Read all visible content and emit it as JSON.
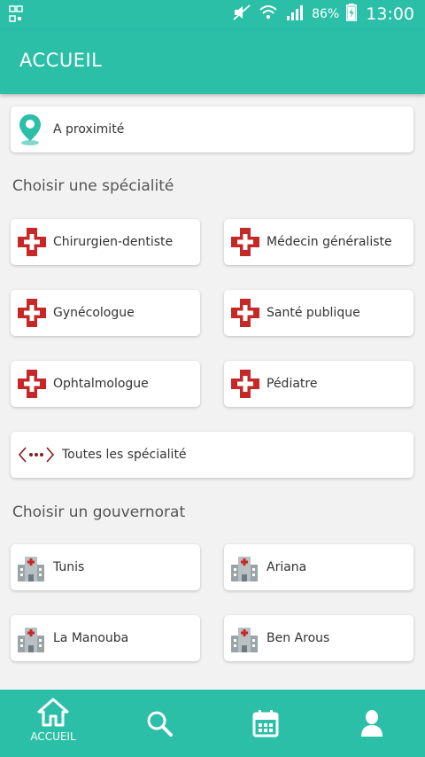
{
  "status_bar": {
    "battery": "86%",
    "time": "13:00"
  },
  "app_bar": {
    "title": "ACCUEIL"
  },
  "nearby": {
    "label": "A proximité"
  },
  "specialities": {
    "title": "Choisir une spécialité",
    "items": [
      {
        "label": "Chirurgien-dentiste"
      },
      {
        "label": "Médecin généraliste"
      },
      {
        "label": "Gynécologue"
      },
      {
        "label": "Santé publique"
      },
      {
        "label": "Ophtalmologue"
      },
      {
        "label": "Pédiatre"
      }
    ],
    "all_label": "Toutes les spécialité"
  },
  "governorates": {
    "title": "Choisir un gouvernorat",
    "items": [
      {
        "label": "Tunis"
      },
      {
        "label": "Ariana"
      },
      {
        "label": "La Manouba"
      },
      {
        "label": "Ben Arous"
      }
    ]
  },
  "bottom_nav": {
    "items": [
      {
        "icon": "home-icon",
        "label": "ACCUEIL"
      },
      {
        "icon": "search-icon",
        "label": ""
      },
      {
        "icon": "calendar-icon",
        "label": ""
      },
      {
        "icon": "user-icon",
        "label": ""
      }
    ]
  },
  "colors": {
    "primary": "#2bbfa8",
    "cross": "#c62828",
    "more": "#8b1a1a"
  }
}
